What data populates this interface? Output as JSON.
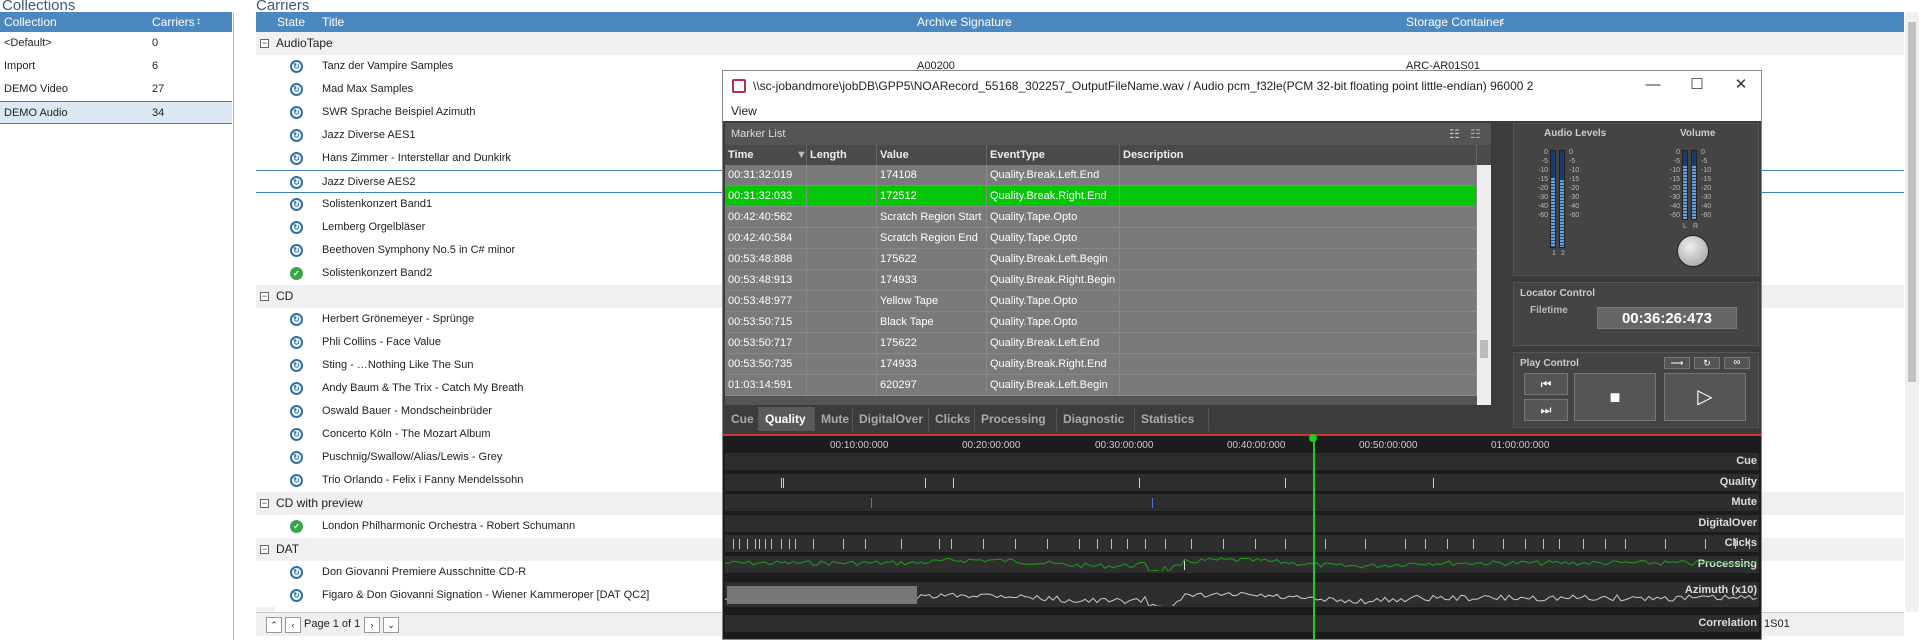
{
  "collections": {
    "title": "Collections",
    "col_collection": "Collection",
    "col_carriers": "Carriers",
    "sort_icon": "↕",
    "rows": [
      {
        "name": "<Default>",
        "count": "0"
      },
      {
        "name": "Import",
        "count": "6"
      },
      {
        "name": "DEMO Video",
        "count": "27"
      },
      {
        "name": "DEMO Audio",
        "count": "34"
      }
    ]
  },
  "carriers": {
    "title": "Carriers",
    "col_state": "State",
    "col_title": "Title",
    "col_archive": "Archive Signature",
    "col_storage": "Storage Container",
    "sort_icon": "↕",
    "groups": [
      {
        "name": "AudioTape",
        "rows": [
          {
            "title": "Tanz der Vampire Samples",
            "archive": "A00200",
            "storage": "ARC-AR01S01",
            "state": "sync"
          },
          {
            "title": "Mad Max Samples",
            "archive": "",
            "storage": "",
            "state": "sync"
          },
          {
            "title": "SWR Sprache Beispiel Azimuth",
            "archive": "",
            "storage": "",
            "state": "sync"
          },
          {
            "title": "Jazz Diverse AES1",
            "archive": "",
            "storage": "",
            "state": "sync"
          },
          {
            "title": "Hans Zimmer - Interstellar and Dunkirk",
            "archive": "",
            "storage": "",
            "state": "sync"
          },
          {
            "title": "Jazz Diverse AES2",
            "archive": "",
            "storage": "",
            "state": "sync"
          },
          {
            "title": "Solistenkonzert Band1",
            "archive": "",
            "storage": "",
            "state": "sync"
          },
          {
            "title": "Lemberg Orgelbläser",
            "archive": "",
            "storage": "",
            "state": "sync"
          },
          {
            "title": "Beethoven Symphony No.5 in C# minor",
            "archive": "",
            "storage": "",
            "state": "sync"
          },
          {
            "title": "Solistenkonzert Band2",
            "archive": "",
            "storage": "",
            "state": "ok"
          }
        ]
      },
      {
        "name": "CD",
        "rows": [
          {
            "title": "Herbert Grönemeyer - Sprünge",
            "state": "sync"
          },
          {
            "title": "Phli Collins - Face Value",
            "state": "sync"
          },
          {
            "title": "Sting - …Nothing Like The Sun",
            "state": "sync"
          },
          {
            "title": "Andy Baum & The Trix - Catch My Breath",
            "state": "sync"
          },
          {
            "title": "Oswald Bauer - Mondscheinbrüder",
            "state": "sync"
          },
          {
            "title": "Concerto Köln - The Mozart Album",
            "state": "sync"
          },
          {
            "title": "Puschnig/Swallow/Alias/Lewis - Grey",
            "state": "sync"
          },
          {
            "title": "Trio Orlando - Felix i Fanny Mendelssohn",
            "state": "sync"
          }
        ]
      },
      {
        "name": "CD with preview",
        "rows": [
          {
            "title": "London Philharmonic Orchestra - Robert Schumann",
            "state": "ok"
          }
        ]
      },
      {
        "name": "DAT",
        "rows": [
          {
            "title": "Don Giovanni Premiere Ausschnitte CD-R",
            "state": "sync"
          },
          {
            "title": "Figaro & Don Giovanni Signation - Wiener Kammeroper [DAT QC2]",
            "state": "sync"
          }
        ]
      }
    ],
    "pager_text": "Page 1 of 1",
    "bottom_storage_partial": "1S01"
  },
  "player": {
    "title": "\\\\sc-jobandmore\\jobDB\\GPP5\\NOARecord_55168_302257_OutputFileName.wav / Audio pcm_f32le(PCM 32-bit floating point little-endian) 96000 2",
    "menu_view": "View",
    "marker_list_label": "Marker List",
    "columns": {
      "time": "Time",
      "length": "Length",
      "value": "Value",
      "event": "EventType",
      "desc": "Description"
    },
    "markers": [
      {
        "time": "00:31:32:019",
        "length": "",
        "value": "174108",
        "event": "Quality.Break.Left.End",
        "desc": ""
      },
      {
        "time": "00:31:32:033",
        "length": "",
        "value": "172512",
        "event": "Quality.Break.Right.End",
        "desc": "",
        "highlight": true
      },
      {
        "time": "00:42:40:562",
        "length": "",
        "value": "Scratch Region Start",
        "event": "Quality.Tape.Opto",
        "desc": ""
      },
      {
        "time": "00:42:40:584",
        "length": "",
        "value": "Scratch Region End",
        "event": "Quality.Tape.Opto",
        "desc": ""
      },
      {
        "time": "00:53:48:888",
        "length": "",
        "value": "175622",
        "event": "Quality.Break.Left.Begin",
        "desc": ""
      },
      {
        "time": "00:53:48:913",
        "length": "",
        "value": "174933",
        "event": "Quality.Break.Right.Begin",
        "desc": ""
      },
      {
        "time": "00:53:48:977",
        "length": "",
        "value": "Yellow Tape",
        "event": "Quality.Tape.Opto",
        "desc": ""
      },
      {
        "time": "00:53:50:715",
        "length": "",
        "value": "Black Tape",
        "event": "Quality.Tape.Opto",
        "desc": ""
      },
      {
        "time": "00:53:50:717",
        "length": "",
        "value": "175622",
        "event": "Quality.Break.Left.End",
        "desc": ""
      },
      {
        "time": "00:53:50:735",
        "length": "",
        "value": "174933",
        "event": "Quality.Break.Right.End",
        "desc": ""
      },
      {
        "time": "01:03:14:591",
        "length": "",
        "value": "620297",
        "event": "Quality.Break.Left.Begin",
        "desc": ""
      }
    ],
    "tabs": [
      "Cue",
      "Quality",
      "Mute",
      "DigitalOver",
      "Clicks",
      "Processing",
      "Diagnostic",
      "Statistics"
    ],
    "active_tab": "Quality",
    "audio_levels_label": "Audio Levels",
    "volume_label": "Volume",
    "level_scale": [
      "0",
      "-5",
      "-10",
      "-15",
      "-20",
      "-30",
      "-40",
      "-60"
    ],
    "channel_labels": [
      "1",
      "2"
    ],
    "lr_labels": [
      "L",
      "R"
    ],
    "levels": {
      "ch1": 0.72,
      "ch2": 0.7,
      "vol_l": 0.78,
      "vol_r": 0.78
    },
    "locator_label": "Locator Control",
    "filetime_label": "Filetime",
    "filetime": "00:36:26:473",
    "play_control_label": "Play Control",
    "timeline_ticks": [
      "00:10:00:000",
      "00:20:00:000",
      "00:30:00:000",
      "00:40:00:000",
      "00:50:00:000",
      "01:00:00:000"
    ],
    "lanes": [
      "Cue",
      "Quality",
      "Mute",
      "DigitalOver",
      "Clicks",
      "Processing",
      "Azimuth (x10)",
      "Correlation"
    ],
    "colors": {
      "highlight": "#06c406",
      "playhead": "#1ad01a",
      "quality_marker": "#e0e040",
      "mute_marker": "#4a7ad8",
      "clicks_marker": "#e8b878",
      "azimuth_line": "#1aa01a",
      "correlation_line": "#cccccc"
    }
  }
}
